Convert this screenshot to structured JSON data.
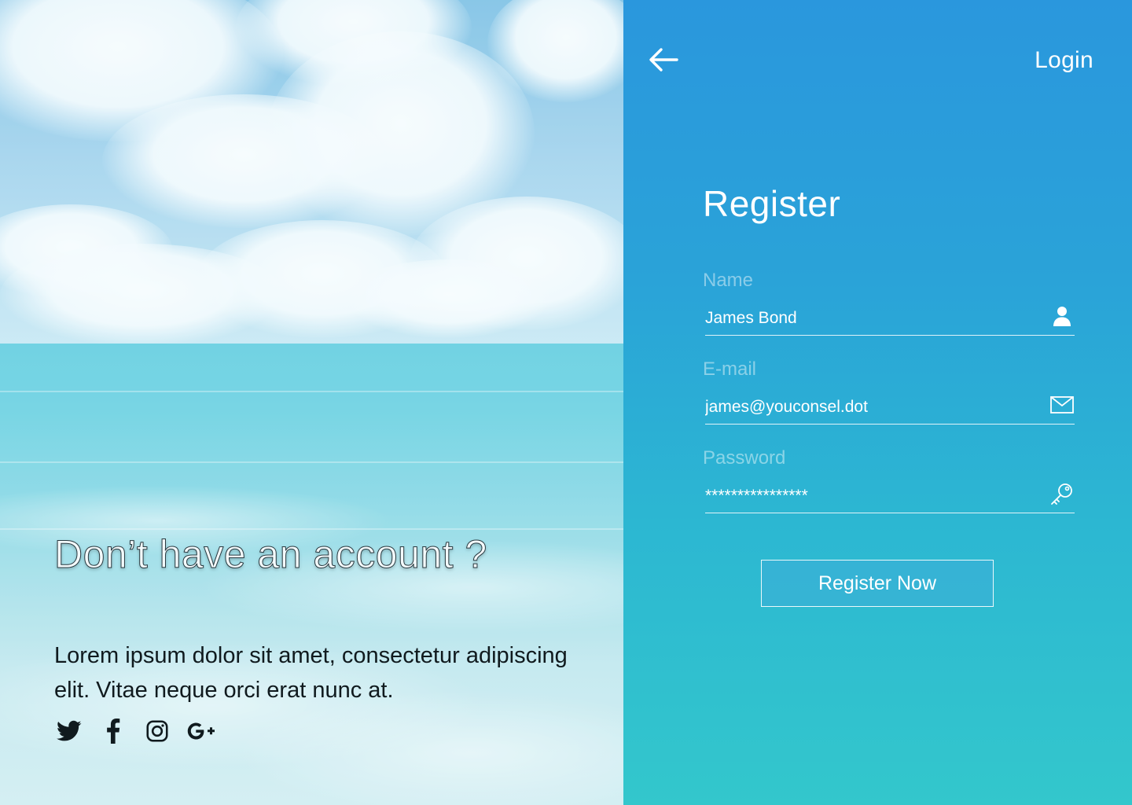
{
  "hero": {
    "title": "Don’t have an account ?",
    "description": "Lorem ipsum dolor sit amet, consectetur adipiscing elit. Vitae neque orci erat nunc at.",
    "socials": [
      {
        "name": "twitter-icon"
      },
      {
        "name": "facebook-icon"
      },
      {
        "name": "instagram-icon"
      },
      {
        "name": "google-plus-icon"
      }
    ]
  },
  "header": {
    "back_icon": "arrow-left-icon",
    "login_label": "Login"
  },
  "form": {
    "title": "Register",
    "name": {
      "label": "Name",
      "value": "James Bond",
      "icon": "user-icon"
    },
    "email": {
      "label": "E-mail",
      "value": "james@youconsel.dot",
      "icon": "mail-icon"
    },
    "password": {
      "label": "Password",
      "value": "****************",
      "icon": "key-icon"
    },
    "submit_label": "Register Now"
  },
  "colors": {
    "panel_top": "#2a97dd",
    "panel_bottom": "#33c7cc",
    "text": "#ffffff"
  }
}
